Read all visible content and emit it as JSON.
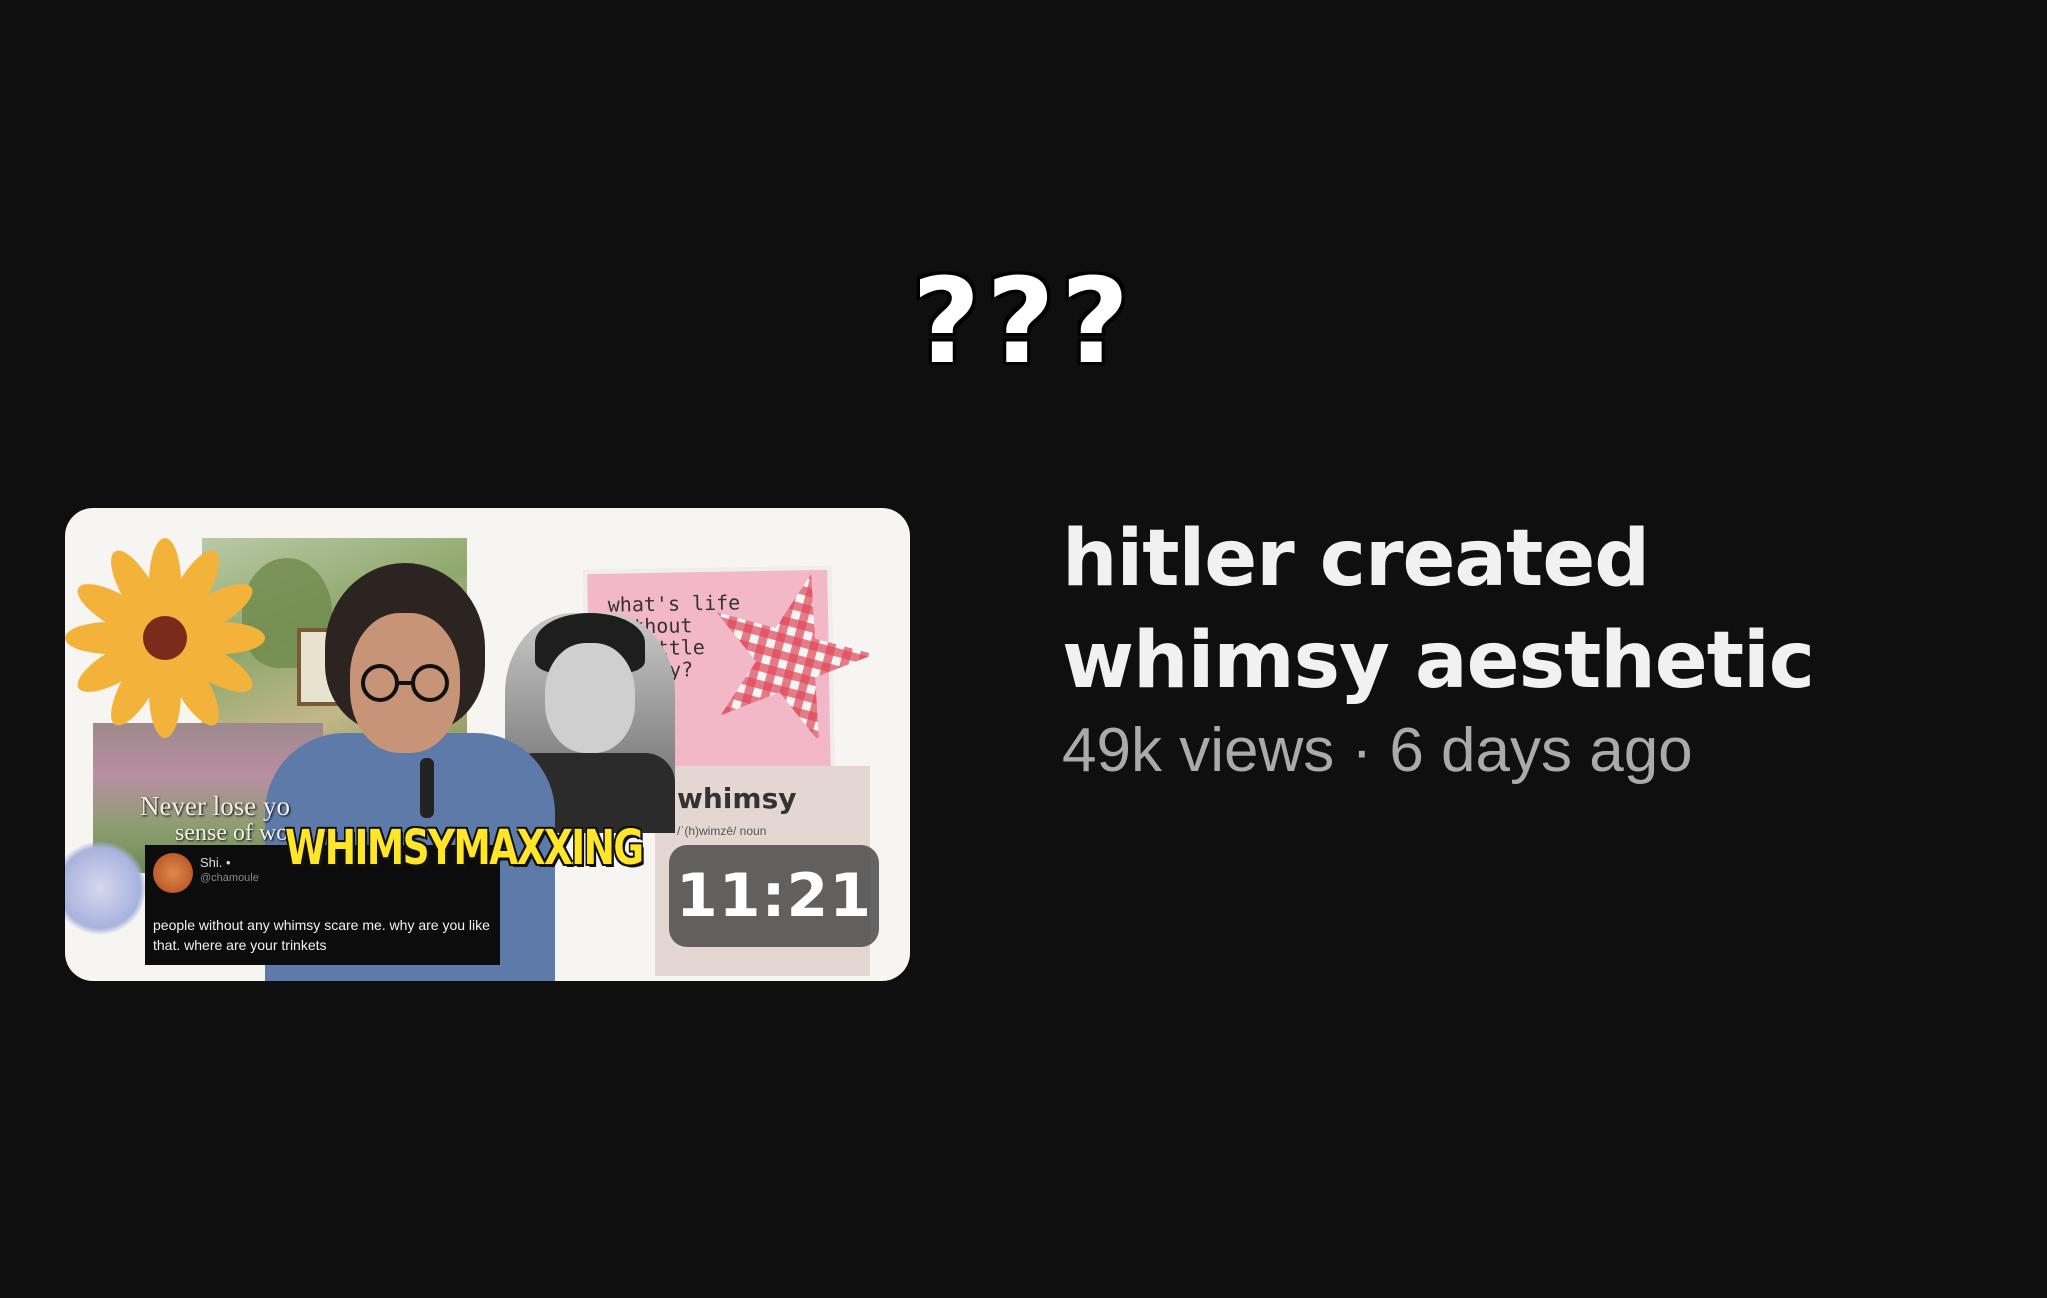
{
  "caption": "???",
  "video": {
    "title": "hitler created whimsy aesthetic",
    "stats": "49k views · 6 days ago",
    "duration": "11:21",
    "thumbnail": {
      "banner_text": "WHIMSYMAXXING",
      "never_text_1": "Never lose yo",
      "never_text_2": "sense of wo",
      "pink_note_text": "what's life\nwithout\na little\nwhimsy?",
      "definition_word": "whimsy",
      "definition_pos": "/ˈ(h)wimzē/ noun",
      "tweet": {
        "name": "Shi. •",
        "handle": "@chamoule",
        "text": "people without any whimsy scare me. why are you like that. where are your trinkets"
      }
    },
    "menu_icon": "more-vertical-icon"
  },
  "colors": {
    "background": "#0f0f10",
    "title": "#f1f1f1",
    "stats": "#aaaaaa",
    "banner": "#ffe629"
  }
}
